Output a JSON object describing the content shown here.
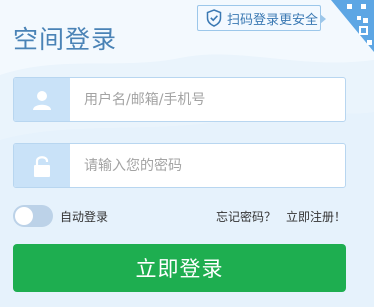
{
  "header": {
    "title": "空间登录",
    "qr_tip": "扫码登录更安全"
  },
  "form": {
    "username_placeholder": "用户名/邮箱/手机号",
    "password_placeholder": "请输入您的密码",
    "auto_login_label": "自动登录",
    "auto_login_on": false,
    "forgot_password": "忘记密码？",
    "register": "立即注册！",
    "submit_label": "立即登录"
  },
  "icons": {
    "qr_tip": "shield-check-icon",
    "qr_corner": "qr-code-icon",
    "username": "user-icon",
    "password": "lock-icon"
  },
  "colors": {
    "accent": "#1eae50",
    "title": "#4a83b6",
    "field_icon_bg": "#c9e2f8"
  }
}
